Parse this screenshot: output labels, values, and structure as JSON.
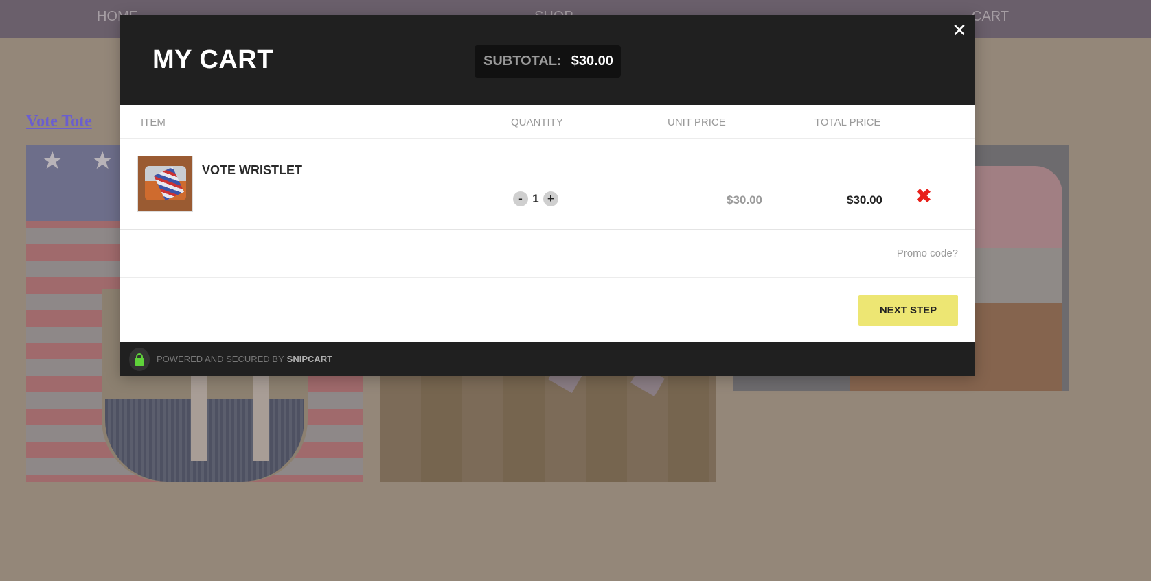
{
  "nav": {
    "home": "HOME",
    "shop": "SHOP",
    "cart": "CART"
  },
  "page": {
    "product_title": "Vote Tote"
  },
  "cart": {
    "title": "MY CART",
    "subtotal_label": "SUBTOTAL:",
    "subtotal_value": "$30.00",
    "close_icon": "close-icon",
    "columns": {
      "item": "ITEM",
      "quantity": "QUANTITY",
      "unit_price": "UNIT PRICE",
      "total_price": "TOTAL PRICE"
    },
    "items": [
      {
        "name": "VOTE WRISTLET",
        "quantity": "1",
        "unit_price": "$30.00",
        "total_price": "$30.00",
        "decrement_label": "-",
        "increment_label": "+"
      }
    ],
    "promo_label": "Promo code?",
    "next_label": "NEXT STEP",
    "footer": {
      "powered_text": "POWERED AND SECURED BY",
      "brand": "SNIPCART"
    }
  },
  "colors": {
    "header_bg": "#202020",
    "next_button": "#ede673",
    "remove_icon": "#e8201a",
    "lock_icon": "#5fd23a"
  }
}
